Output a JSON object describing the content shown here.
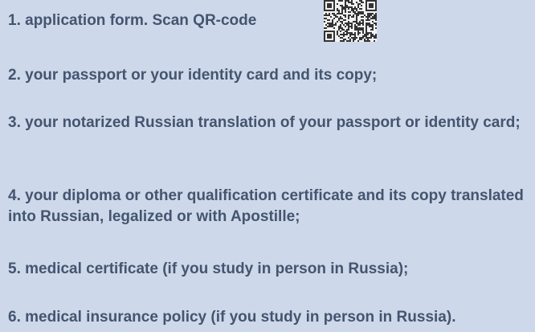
{
  "items": [
    "1. application form. Scan QR-code",
    "2. your passport or your identity card and its copy;",
    "3. your notarized Russian translation of your passport or identity card;",
    "4. your diploma or other qualification certificate and its copy translated into Russian, legalized or with Apostille;",
    "5. medical certificate (if you study in person in Russia);",
    "6. medical insurance policy (if you study in person in Russia)."
  ],
  "qr_code": {
    "icon": "qr-code-icon",
    "fg_color": "#333333",
    "bg_color": "#f2f2f2"
  },
  "colors": {
    "background": "#cdd9ea",
    "text": "#45546f"
  }
}
